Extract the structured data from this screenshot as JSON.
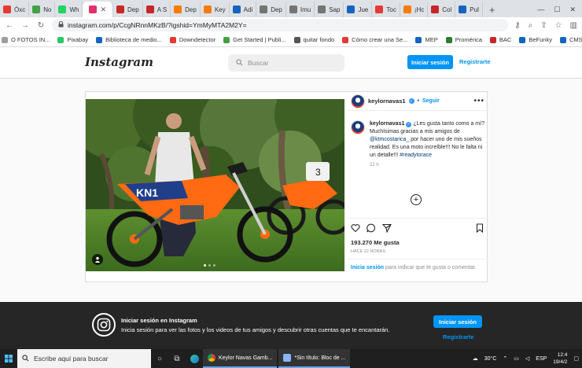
{
  "browser": {
    "tabs": [
      {
        "label": "Óxc",
        "color": "#e53935"
      },
      {
        "label": "No",
        "color": "#43a047"
      },
      {
        "label": "Wh",
        "color": "#25d366"
      },
      {
        "label": "",
        "color": "#e1306c",
        "active": true
      },
      {
        "label": "Dep",
        "color": "#c62828"
      },
      {
        "label": "A S",
        "color": "#c62828"
      },
      {
        "label": "Dep",
        "color": "#f57c00"
      },
      {
        "label": "Key",
        "color": "#f57c00"
      },
      {
        "label": "Adi",
        "color": "#1565c0"
      },
      {
        "label": "Dep",
        "color": "#757575"
      },
      {
        "label": "Imu",
        "color": "#757575"
      },
      {
        "label": "Sap",
        "color": "#757575"
      },
      {
        "label": "Jue",
        "color": "#1565c0"
      },
      {
        "label": "Toc",
        "color": "#e53935"
      },
      {
        "label": "¡Hc",
        "color": "#f57c00"
      },
      {
        "label": "Col",
        "color": "#c62828"
      },
      {
        "label": "Pul",
        "color": "#1565c0"
      }
    ],
    "new_tab": "+",
    "url": "instagram.com/p/CcgNRnnMKzB/?igshid=YmMyMTA2M2Y=",
    "bookmarks": [
      {
        "label": "O FOTOS IN...",
        "color": "#9e9e9e"
      },
      {
        "label": "Pixabay",
        "color": "#2ec66d"
      },
      {
        "label": "Biblioteca de medio...",
        "color": "#1565c0"
      },
      {
        "label": "Downdetector",
        "color": "#e53935"
      },
      {
        "label": "Get Started | Publi...",
        "color": "#43a047"
      },
      {
        "label": "quitar fondo",
        "color": "#555555"
      },
      {
        "label": "Cómo crear una Se...",
        "color": "#e53935"
      },
      {
        "label": "MEP",
        "color": "#1565c0"
      },
      {
        "label": "Promérica",
        "color": "#2e7d32"
      },
      {
        "label": "BAC",
        "color": "#c62828"
      },
      {
        "label": "BeFunky",
        "color": "#1565c0"
      },
      {
        "label": "CMS",
        "color": "#1565c0"
      }
    ]
  },
  "instagram": {
    "logo": "Instagram",
    "search_placeholder": "Buscar",
    "login_button": "Iniciar sesión",
    "register_link": "Registrarte"
  },
  "post": {
    "username": "keylornavas1",
    "follow": "Seguir",
    "caption_user": "keylornavas1",
    "caption_text": " ¿Les gusta tanto como a mí? Muchísimas gracias a mis amigos de ",
    "caption_mention": "@ktmcostarica_",
    "caption_rest": " por hacer uno de mis sueños realidad. Es una moto increíble!!! No le falta ni un detalle!!! ",
    "caption_hashtag": "#readytorace",
    "caption_time": "22 h",
    "likes": "193.270 Me gusta",
    "time_ago": "HACE 22 HORAS",
    "login_link": "Inicia sesión",
    "login_text": " para indicar que te gusta o comentar."
  },
  "banner": {
    "title": "Iniciar sesión en Instagram",
    "subtitle": "Inicia sesión para ver las fotos y los videos de tus amigos y descubrir otras cuentas que te encantarán.",
    "button": "Iniciar sesión",
    "register": "Registrarte"
  },
  "taskbar": {
    "search_placeholder": "Escribe aquí para buscar",
    "apps": [
      {
        "label": "Keylor Navas Gamb..."
      },
      {
        "label": "*Sin título: Bloc de ..."
      }
    ],
    "weather": "30°C",
    "lang": "ESP",
    "time": "12:4",
    "date": "19/4/2"
  }
}
